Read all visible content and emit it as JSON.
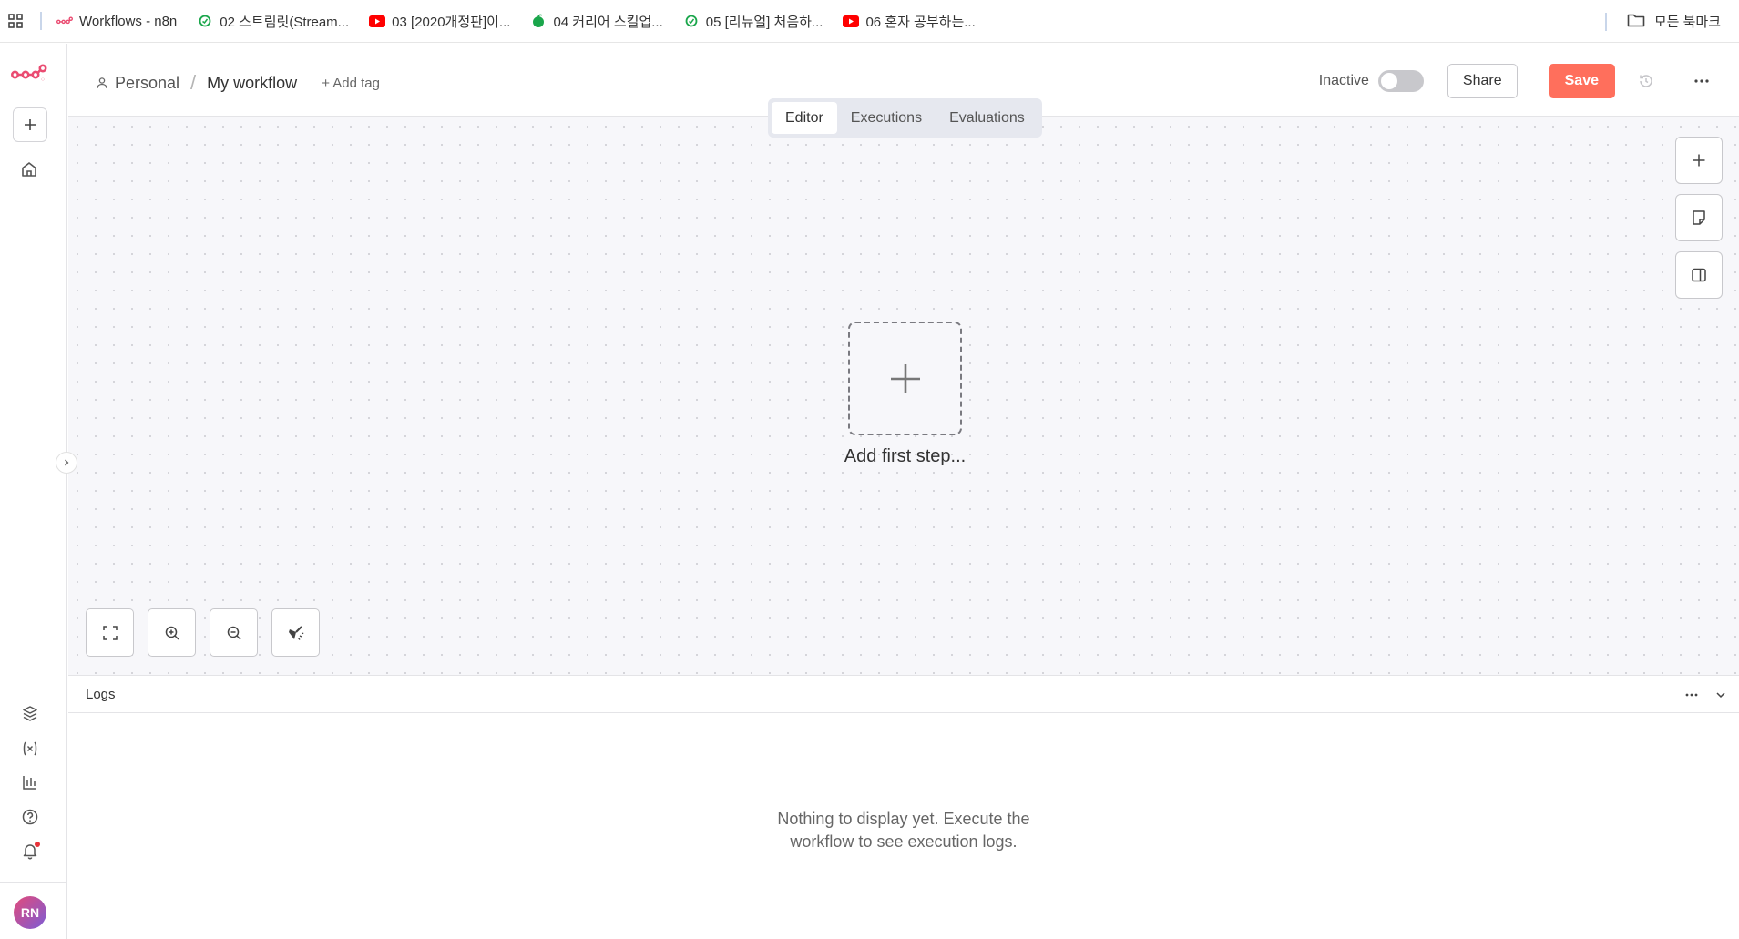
{
  "bookmarks": {
    "items": [
      {
        "label": "Workflows - n8n",
        "icon": "n8n-logo-icon"
      },
      {
        "label": "02 스트림릿(Stream...",
        "icon": "green-circle-icon"
      },
      {
        "label": "03 [2020개정판]이...",
        "icon": "youtube-icon"
      },
      {
        "label": "04 커리어 스킬업...",
        "icon": "green-leaf-icon"
      },
      {
        "label": "05 [리뉴얼] 처음하...",
        "icon": "green-circle-icon"
      },
      {
        "label": "06 혼자 공부하는...",
        "icon": "youtube-icon"
      }
    ],
    "all_bookmarks": "모든 북마크"
  },
  "header": {
    "project": "Personal",
    "workflow_name": "My workflow",
    "add_tag": "+ Add tag",
    "status_label": "Inactive",
    "share_label": "Share",
    "save_label": "Save"
  },
  "tabs": [
    {
      "label": "Editor",
      "active": true
    },
    {
      "label": "Executions",
      "active": false
    },
    {
      "label": "Evaluations",
      "active": false
    }
  ],
  "canvas": {
    "add_first_step": "Add first step..."
  },
  "logs": {
    "title": "Logs",
    "empty_message": "Nothing to display yet. Execute the workflow to see execution logs."
  },
  "user": {
    "initials": "RN"
  },
  "colors": {
    "brand": "#ea4b71",
    "save": "#ff6f5c",
    "youtube": "#ff0000",
    "green": "#1aa64b"
  }
}
